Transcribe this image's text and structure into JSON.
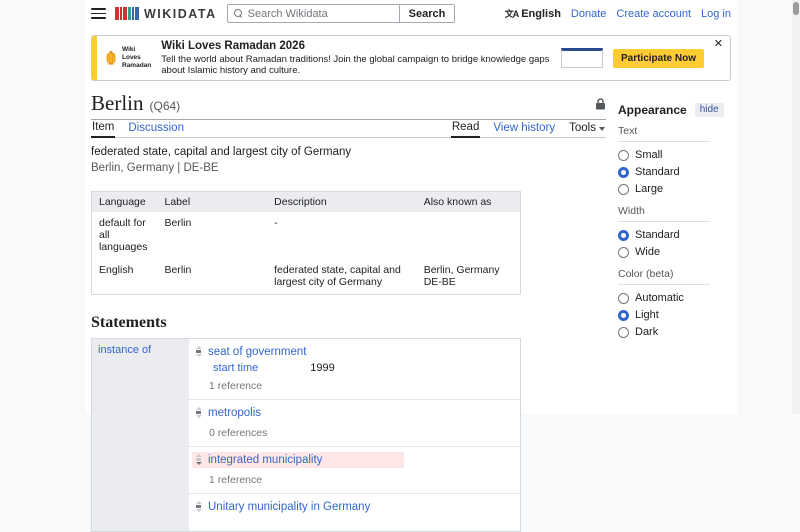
{
  "colors": {
    "accent_blue": "#3366cc",
    "banner_yellow": "#ffcc33",
    "deprecated_pink": "#fee7e6"
  },
  "header": {
    "logo_text": "WIKIDATA",
    "search_placeholder": "Search Wikidata",
    "search_button": "Search",
    "language_label": "English",
    "language_icon": "文A",
    "donate": "Donate",
    "create_account": "Create account",
    "log_in": "Log in"
  },
  "banner": {
    "badge_line1": "Wiki",
    "badge_line2": "Loves",
    "badge_line3": "Ramadan",
    "title": "Wiki Loves Ramadan 2026",
    "subtitle": "Tell the world about Ramadan traditions! Join the global campaign to bridge knowledge gaps about Islamic history and culture.",
    "cta_label": "Participate Now",
    "close_glyph": "✕"
  },
  "entity": {
    "title": "Berlin",
    "id": "(Q64)",
    "description": "federated state, capital and largest city of Germany",
    "aliases_line": "Berlin, Germany | DE-BE"
  },
  "page_tabs": {
    "item": "Item",
    "discussion": "Discussion",
    "read": "Read",
    "view_history": "View history",
    "tools": "Tools"
  },
  "terms_table": {
    "headers": [
      "Language",
      "Label",
      "Description",
      "Also known as"
    ],
    "rows": [
      {
        "language": "default for all languages",
        "label": "Berlin",
        "description": "-",
        "aliases": []
      },
      {
        "language": "English",
        "label": "Berlin",
        "description": "federated state, capital and largest city of Germany",
        "aliases": [
          "Berlin, Germany",
          "DE-BE"
        ]
      }
    ]
  },
  "statements": {
    "heading": "Statements",
    "property": "instance of",
    "claims": [
      {
        "value": "seat of government",
        "rank": "normal",
        "qualifier_property": "start time",
        "qualifier_value": "1999",
        "references": "1 reference"
      },
      {
        "value": "metropolis",
        "rank": "normal",
        "references": "0 references"
      },
      {
        "value": "integrated municipality",
        "rank": "deprecated",
        "references": "1 reference"
      },
      {
        "value": "Unitary municipality in Germany",
        "rank": "normal"
      }
    ]
  },
  "appearance": {
    "title": "Appearance",
    "hide_label": "hide",
    "sections": [
      {
        "label": "Text",
        "options": [
          {
            "label": "Small",
            "selected": false
          },
          {
            "label": "Standard",
            "selected": true
          },
          {
            "label": "Large",
            "selected": false
          }
        ]
      },
      {
        "label": "Width",
        "options": [
          {
            "label": "Standard",
            "selected": true
          },
          {
            "label": "Wide",
            "selected": false
          }
        ]
      },
      {
        "label": "Color (beta)",
        "options": [
          {
            "label": "Automatic",
            "selected": false
          },
          {
            "label": "Light",
            "selected": true
          },
          {
            "label": "Dark",
            "selected": false
          }
        ]
      }
    ]
  }
}
